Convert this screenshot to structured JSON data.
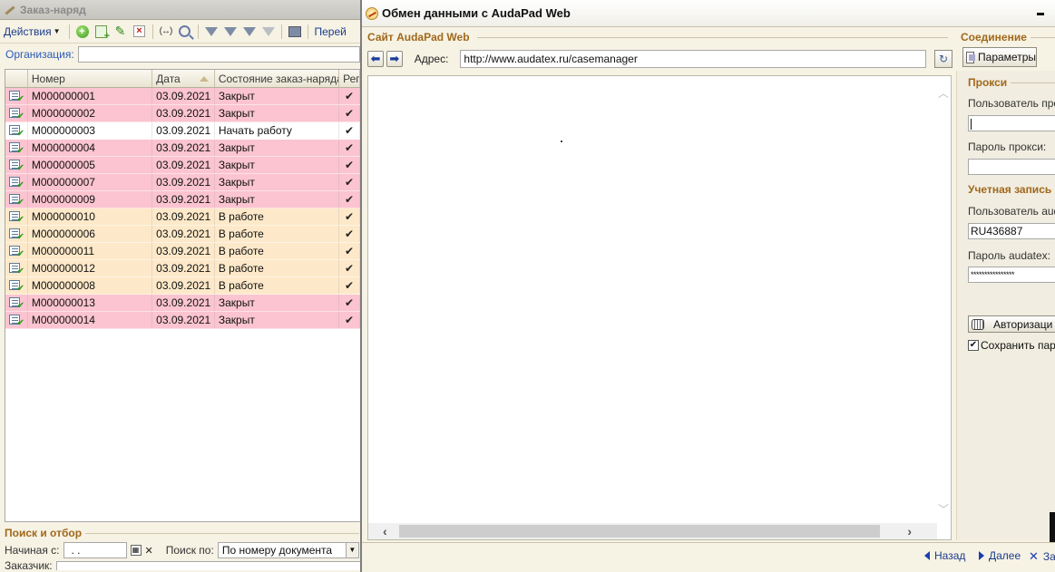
{
  "left": {
    "title": "Заказ-наряд",
    "toolbar": {
      "actions_label": "Действия",
      "goto_label": "Перей"
    },
    "org_label": "Организация:",
    "columns": {
      "number": "Номер",
      "date": "Дата",
      "state": "Состояние заказ-наряда",
      "flag": "Рег"
    },
    "rows": [
      {
        "number": "М000000001",
        "date": "03.09.2021",
        "state": "Закрыт",
        "flag": "✔"
      },
      {
        "number": "М000000002",
        "date": "03.09.2021",
        "state": "Закрыт",
        "flag": "✔"
      },
      {
        "number": "М000000003",
        "date": "03.09.2021",
        "state": "Начать работу",
        "flag": "✔"
      },
      {
        "number": "М000000004",
        "date": "03.09.2021",
        "state": "Закрыт",
        "flag": "✔"
      },
      {
        "number": "М000000005",
        "date": "03.09.2021",
        "state": "Закрыт",
        "flag": "✔"
      },
      {
        "number": "М000000007",
        "date": "03.09.2021",
        "state": "Закрыт",
        "flag": "✔"
      },
      {
        "number": "М000000009",
        "date": "03.09.2021",
        "state": "Закрыт",
        "flag": "✔"
      },
      {
        "number": "М000000010",
        "date": "03.09.2021",
        "state": "В работе",
        "flag": "✔"
      },
      {
        "number": "М000000006",
        "date": "03.09.2021",
        "state": "В работе",
        "flag": "✔"
      },
      {
        "number": "М000000011",
        "date": "03.09.2021",
        "state": "В работе",
        "flag": "✔"
      },
      {
        "number": "М000000012",
        "date": "03.09.2021",
        "state": "В работе",
        "flag": "✔"
      },
      {
        "number": "М000000008",
        "date": "03.09.2021",
        "state": "В работе",
        "flag": "✔"
      },
      {
        "number": "М000000013",
        "date": "03.09.2021",
        "state": "Закрыт",
        "flag": "✔"
      },
      {
        "number": "М000000014",
        "date": "03.09.2021",
        "state": "Закрыт",
        "flag": "✔"
      }
    ],
    "search": {
      "title": "Поиск и отбор",
      "start_label": "Начиная с:",
      "start_value": " .  .",
      "search_by_label": "Поиск по:",
      "search_by_value": "По номеру документа",
      "customer_label": "Заказчик:"
    }
  },
  "right": {
    "title": "Обмен данными с AudaPad Web",
    "site_title": "Сайт AudaPad Web",
    "address_label": "Адрес:",
    "address_value": "http://www.audatex.ru/casemanager",
    "connection": {
      "title": "Соединение",
      "params_button": "Параметры",
      "proxy_title": "Прокси",
      "proxy_user_label": "Пользователь прокс",
      "proxy_user_value": "",
      "proxy_pass_label": "Пароль прокси:",
      "proxy_pass_value": "",
      "account_title": "Учетная запись",
      "audatex_user_label": "Пользователь auda",
      "audatex_user_value": "RU436887",
      "audatex_pass_label": "Пароль audatex:",
      "audatex_pass_value": "****************",
      "auth_button": "Авторизаци",
      "save_pass_label": "Сохранить паро"
    },
    "footer": {
      "back_label": "Назад",
      "next_label": "Далее",
      "close_label": "За"
    }
  },
  "colors": {
    "closed_row": "#fbc4d0",
    "in_progress_row": "#fde9c9",
    "start_row": "#ffffff",
    "section_heading": "#a0681c",
    "link": "#1c3c8c"
  }
}
